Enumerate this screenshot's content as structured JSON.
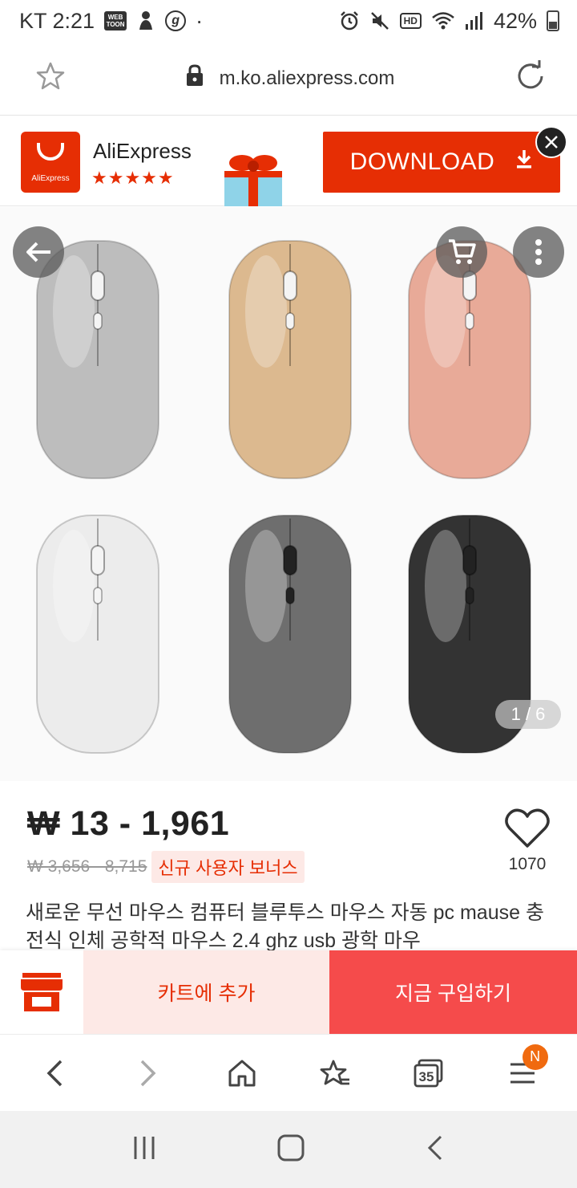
{
  "status_bar": {
    "carrier_time": "KT 2:21",
    "webtoon_label": "WEB TOON",
    "g_label": "g",
    "dot": "·",
    "hd_label": "HD",
    "battery_percent": "42%",
    "battery_level": 0.42
  },
  "url_bar": {
    "url": "m.ko.aliexpress.com",
    "icons": [
      "star-outline-icon",
      "lock-icon",
      "reload-icon"
    ]
  },
  "app_banner": {
    "logo_text": "AliExpress",
    "app_name": "AliExpress",
    "stars": "★★★★★",
    "rating": 4.5,
    "download_label": "DOWNLOAD",
    "accent_color": "#e62e04"
  },
  "product_image": {
    "counter": "1 / 6",
    "mouse_colors": [
      "#bdbdbd",
      "#dcb98f",
      "#e8aa98",
      "#ececec",
      "#6e6e6e",
      "#333333"
    ]
  },
  "product": {
    "price": "₩ 13 - 1,961",
    "original_price": "₩ 3,656 - 8,715",
    "bonus_tag": "신규 사용자 보너스",
    "wishlist_count": "1070",
    "title": "새로운 무선 마우스 컴퓨터 블루투스 마우스 자동 pc mause 충전식 인체 공학적 마우스 2.4 ghz usb 광학 마우"
  },
  "action_bar": {
    "add_to_cart": "카트에 추가",
    "buy_now": "지금 구입하기",
    "buy_color": "#f54b4b"
  },
  "browser_bar": {
    "tabs_count": "35",
    "notification_badge": "N"
  }
}
